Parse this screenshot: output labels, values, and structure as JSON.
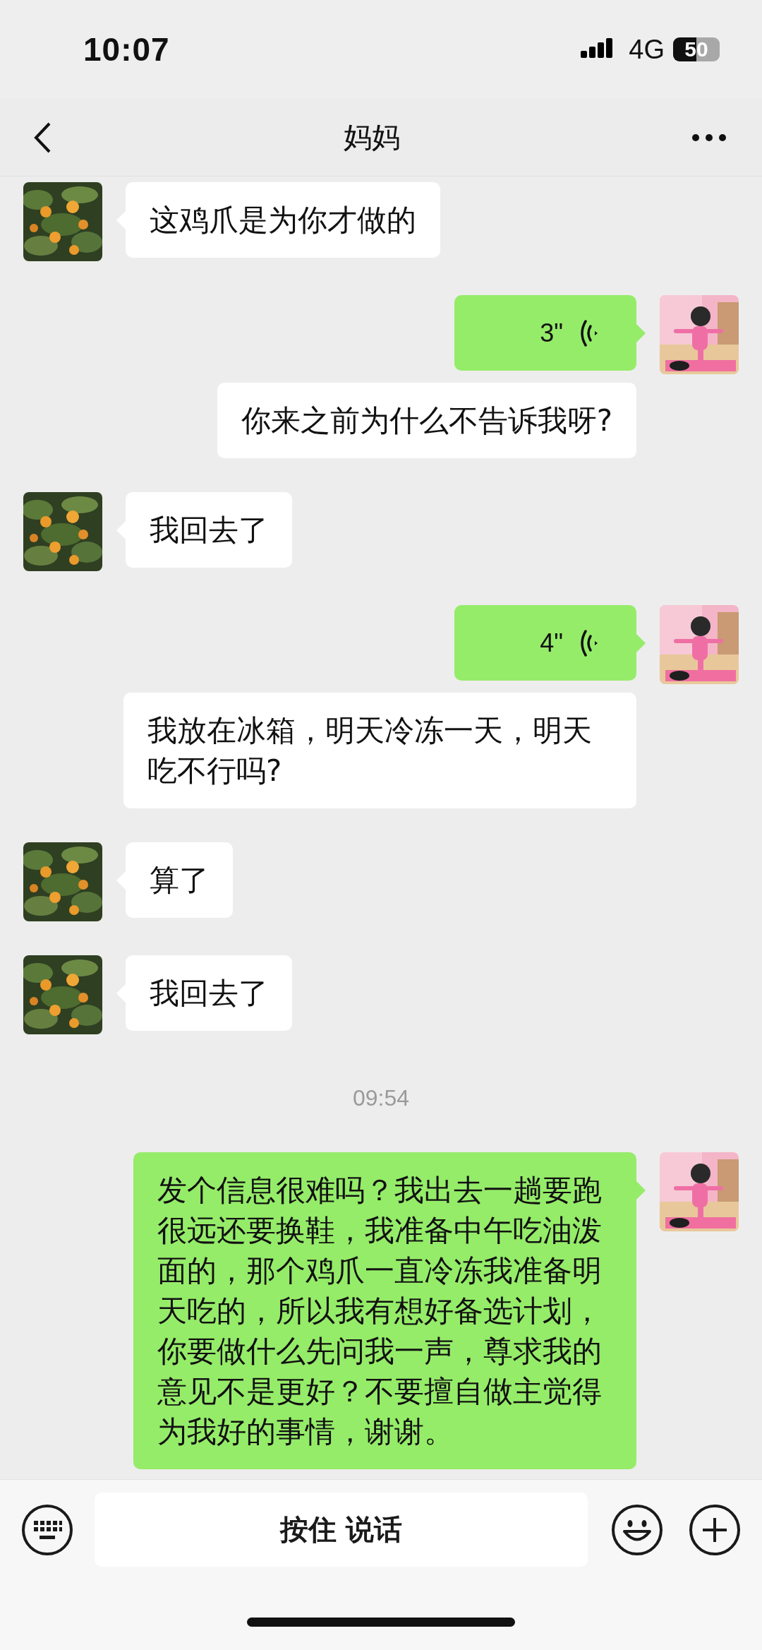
{
  "status_bar": {
    "time": "10:07",
    "network": "4G",
    "battery": "50"
  },
  "header": {
    "title": "妈妈"
  },
  "messages": [
    {
      "kind": "received",
      "avatar": true,
      "text": "这鸡爪是为你才做的"
    },
    {
      "kind": "voice_sent",
      "avatar": true,
      "text": "3\""
    },
    {
      "kind": "received_right",
      "avatar": false,
      "text": "你来之前为什么不告诉我呀?"
    },
    {
      "kind": "received",
      "avatar": true,
      "text": "我回去了"
    },
    {
      "kind": "voice_sent",
      "avatar": true,
      "text": "4\""
    },
    {
      "kind": "received_right",
      "avatar": false,
      "text": "我放在冰箱，明天冷冻一天，明天吃不行吗?"
    },
    {
      "kind": "received",
      "avatar": true,
      "text": "算了"
    },
    {
      "kind": "received",
      "avatar": true,
      "text": "我回去了"
    },
    {
      "kind": "time",
      "text": "09:54"
    },
    {
      "kind": "sent",
      "avatar": true,
      "text": "发个信息很难吗？我出去一趟要跑很远还要换鞋，我准备中午吃油泼面的，那个鸡爪一直冷冻我准备明天吃的，所以我有想好备选计划，你要做什么先问我一声，尊求我的意见不是更好？不要擅自做主觉得为我好的事情，谢谢。"
    }
  ],
  "input_bar": {
    "talk_button": "按住 说话"
  }
}
